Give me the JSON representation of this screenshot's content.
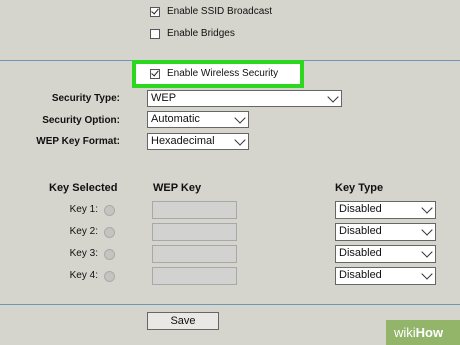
{
  "top_options": [
    {
      "label": "Enable SSID Broadcast",
      "checked": true
    },
    {
      "label": "Enable Bridges",
      "checked": false
    }
  ],
  "wireless_security": {
    "label": "Enable Wireless Security",
    "checked": true
  },
  "fields": {
    "security_type": {
      "label": "Security Type:",
      "value": "WEP"
    },
    "security_option": {
      "label": "Security Option:",
      "value": "Automatic"
    },
    "key_format": {
      "label": "WEP Key Format:",
      "value": "Hexadecimal"
    }
  },
  "key_table": {
    "headers": {
      "selected": "Key Selected",
      "key": "WEP Key",
      "type": "Key Type"
    },
    "rows": [
      {
        "label": "Key 1:",
        "type": "Disabled"
      },
      {
        "label": "Key 2:",
        "type": "Disabled"
      },
      {
        "label": "Key 3:",
        "type": "Disabled"
      },
      {
        "label": "Key 4:",
        "type": "Disabled"
      }
    ]
  },
  "save_label": "Save",
  "watermark": {
    "wiki": "wiki",
    "how": "How"
  },
  "colors": {
    "highlight": "#2bd81f",
    "divider": "#6f95b8",
    "background": "#d5d4cd"
  }
}
